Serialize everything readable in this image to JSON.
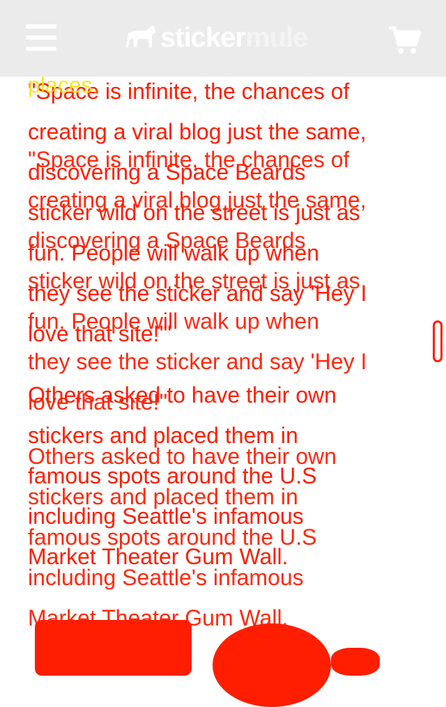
{
  "header": {
    "logo_part1": "sticker",
    "logo_part2": "mule"
  },
  "article": {
    "top_fragment": "places.",
    "quote_lines": [
      "\"Space is infinite, the chances of",
      "creating a viral blog just the same,",
      "discovering a Space Beards",
      "sticker wild on the street is just as",
      "fun. People will walk up when",
      "they see the sticker and say 'Hey I",
      "love that site!'\""
    ],
    "others_lines": [
      "Others asked to have their own",
      "stickers and placed them in",
      "famous spots around the U.S",
      "including Seattle's infamous",
      "Market Theater Gum Wall."
    ]
  },
  "icons": {
    "menu": "hamburger-menu-icon",
    "cart": "shopping-cart-icon",
    "logo_mark": "mule-icon"
  },
  "colors": {
    "header_bg": "#ebebeb",
    "text_red": "#ff1e00",
    "text_yellow": "#ffe100"
  }
}
